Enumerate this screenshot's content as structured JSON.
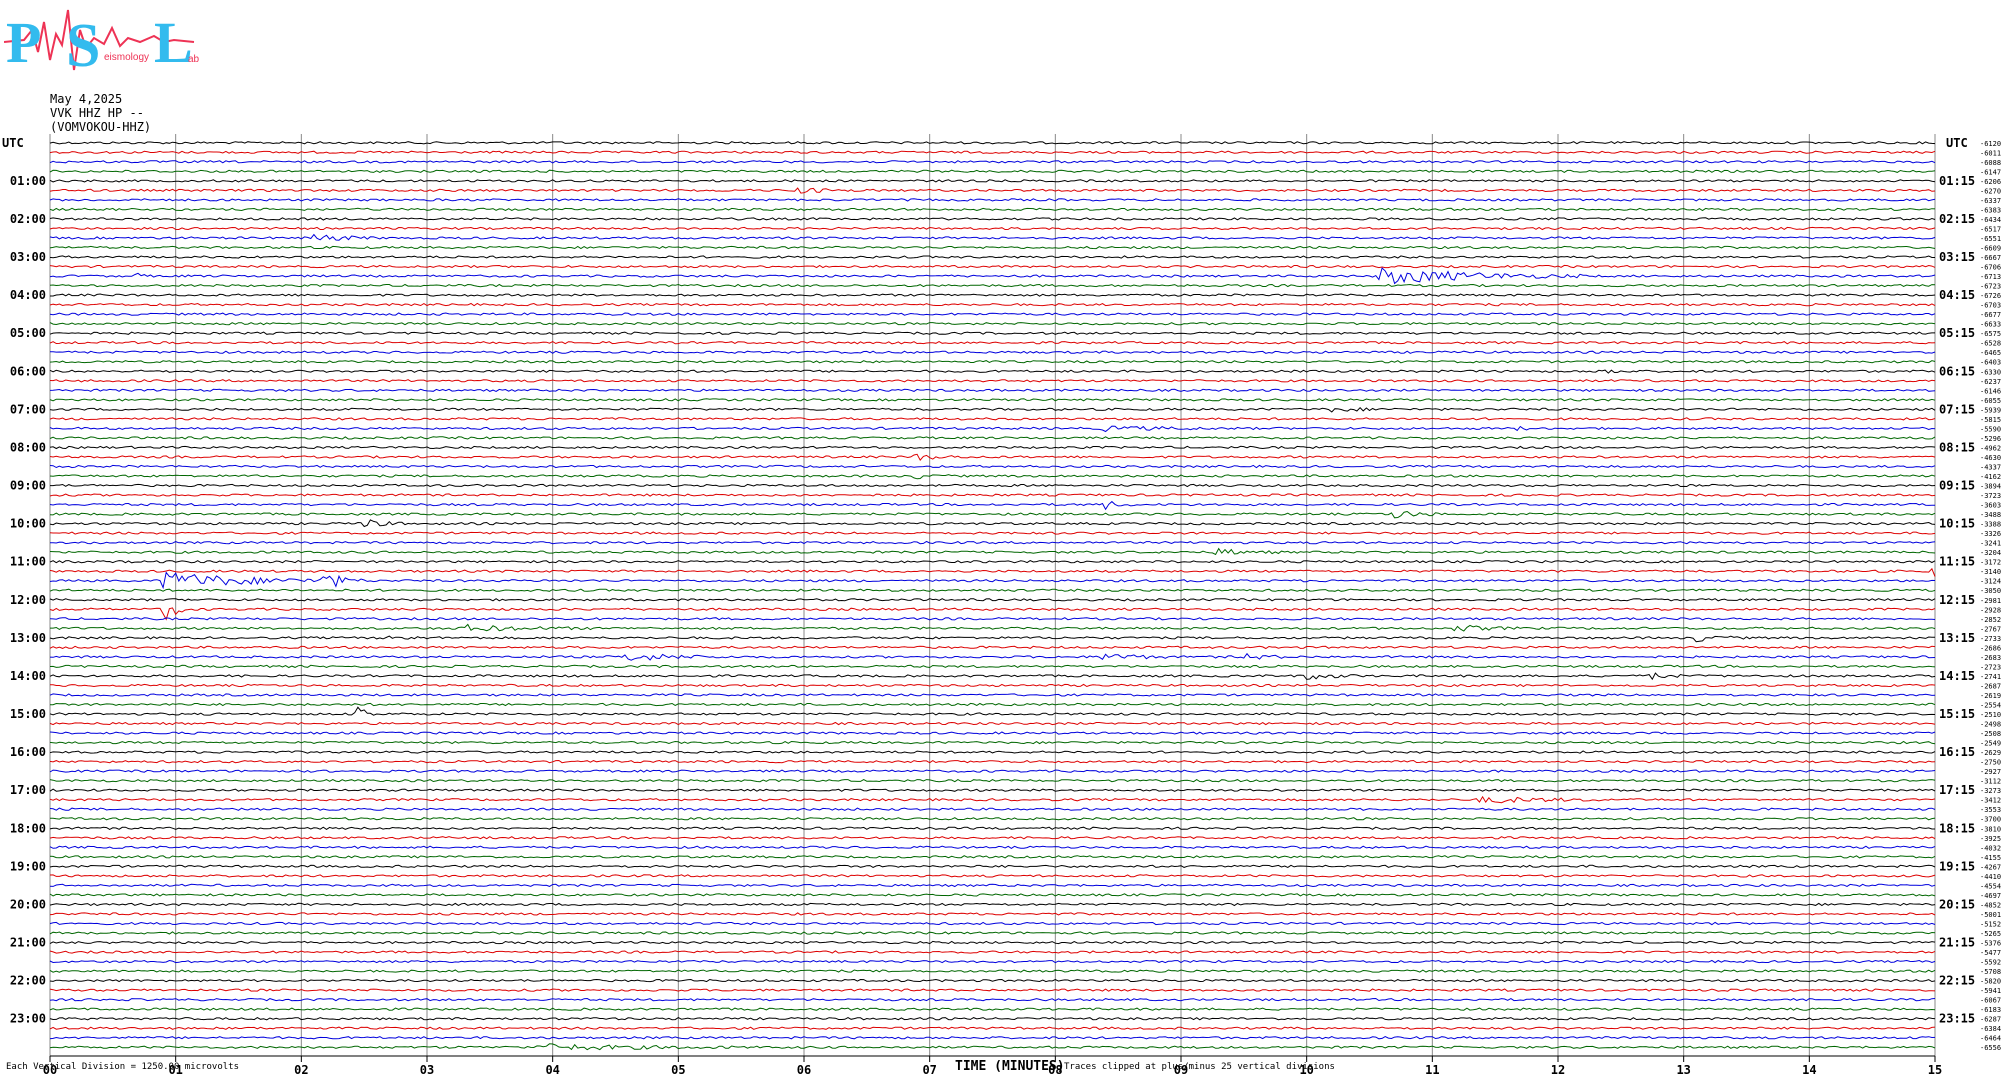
{
  "header": {
    "logo_letters": [
      "P",
      "S",
      "L"
    ],
    "logo_words": [
      "eismology",
      "ab"
    ],
    "date": "May 4,2025",
    "station": "VVK HHZ HP --",
    "station_id": "(VOMVOKOU-HHZ)"
  },
  "axes": {
    "left_title": "UTC",
    "right_title": "UTC",
    "x_title": "TIME (MINUTES)",
    "left_hour_labels": [
      "01:00",
      "02:00",
      "03:00",
      "04:00",
      "05:00",
      "06:00",
      "07:00",
      "08:00",
      "09:00",
      "10:00",
      "11:00",
      "12:00",
      "13:00",
      "14:00",
      "15:00",
      "16:00",
      "17:00",
      "18:00",
      "19:00",
      "20:00",
      "21:00",
      "22:00",
      "23:00"
    ],
    "right_hour_labels": [
      "01:15",
      "02:15",
      "03:15",
      "04:15",
      "05:15",
      "06:15",
      "07:15",
      "08:15",
      "09:15",
      "10:15",
      "11:15",
      "12:15",
      "13:15",
      "14:15",
      "15:15",
      "16:15",
      "17:15",
      "18:15",
      "19:15",
      "20:15",
      "21:15",
      "22:15",
      "23:15"
    ],
    "x_tick_labels": [
      "00",
      "01",
      "02",
      "03",
      "04",
      "05",
      "06",
      "07",
      "08",
      "09",
      "10",
      "11",
      "12",
      "13",
      "14",
      "15"
    ]
  },
  "footer": {
    "scale_note": "Each Vertical Division = 1250.00 microvolts",
    "clip_note": "Traces clipped at plus/minus 25 vertical divisions"
  },
  "colors": {
    "trace_cycle": [
      "#000000",
      "#dd0000",
      "#0000dd",
      "#006600"
    ],
    "grid": "#888888",
    "logo_blue": "#33bbee",
    "logo_red": "#ee3355"
  },
  "chart_data": {
    "type": "line",
    "x_unit": "minutes",
    "xlim": [
      0,
      15
    ],
    "traces_per_hour": 4,
    "trace_count": 96,
    "row_offsets": [
      "-6120",
      "-6011",
      "-6088",
      "-6147",
      "-6206",
      "-6270",
      "-6337",
      "-6383",
      "-6434",
      "-6517",
      "-6551",
      "-6609",
      "-6667",
      "-6706",
      "-6713",
      "-6723",
      "-6726",
      "-6703",
      "-6677",
      "-6633",
      "-6575",
      "-6528",
      "-6465",
      "-6403",
      "-6330",
      "-6237",
      "-6146",
      "-6055",
      "-5939",
      "-5815",
      "-5590",
      "-5296",
      "-4962",
      "-4630",
      "-4337",
      "-4162",
      "-3894",
      "-3723",
      "-3603",
      "-3488",
      "-3388",
      "-3326",
      "-3241",
      "-3204",
      "-3172",
      "-3140",
      "-3124",
      "-3050",
      "-2981",
      "-2928",
      "-2852",
      "-2767",
      "-2733",
      "-2686",
      "-2683",
      "-2723",
      "-2741",
      "-2687",
      "-2619",
      "-2554",
      "-2510",
      "-2498",
      "-2508",
      "-2549",
      "-2629",
      "-2750",
      "-2927",
      "-3112",
      "-3273",
      "-3412",
      "-3553",
      "-3700",
      "-3810",
      "-3925",
      "-4032",
      "-4155",
      "-4267",
      "-4410",
      "-4554",
      "-4697",
      "-4852",
      "-5001",
      "-5152",
      "-5265",
      "-5376",
      "-5477",
      "-5592",
      "-5708",
      "-5820",
      "-5941",
      "-6067",
      "-6183",
      "-6287",
      "-6384",
      "-6464",
      "-6556"
    ],
    "events": [
      {
        "row": 5,
        "minute": 5.9,
        "amp": 3,
        "dur": 0.5
      },
      {
        "row": 10,
        "minute": 2.1,
        "amp": 4,
        "dur": 0.5
      },
      {
        "row": 14,
        "minute": 10.6,
        "amp": 8,
        "dur": 1.6
      },
      {
        "row": 14,
        "minute": 0.7,
        "amp": 2,
        "dur": 0.1
      },
      {
        "row": 24,
        "minute": 12.4,
        "amp": 5,
        "dur": 0.15
      },
      {
        "row": 28,
        "minute": 10.2,
        "amp": 2,
        "dur": 0.5
      },
      {
        "row": 30,
        "minute": 8.4,
        "amp": 2,
        "dur": 1.0
      },
      {
        "row": 30,
        "minute": 11.7,
        "amp": 2,
        "dur": 0.1
      },
      {
        "row": 33,
        "minute": 6.9,
        "amp": 3,
        "dur": 0.4
      },
      {
        "row": 35,
        "minute": 6.9,
        "amp": 2,
        "dur": 0.3
      },
      {
        "row": 38,
        "minute": 8.4,
        "amp": 4,
        "dur": 0.2
      },
      {
        "row": 39,
        "minute": 10.7,
        "amp": 4,
        "dur": 0.4
      },
      {
        "row": 40,
        "minute": 2.5,
        "amp": 5,
        "dur": 0.3
      },
      {
        "row": 43,
        "minute": 9.3,
        "amp": 3,
        "dur": 0.5
      },
      {
        "row": 45,
        "minute": 15.0,
        "amp": 5,
        "dur": 0.3
      },
      {
        "row": 46,
        "minute": 0.9,
        "amp": 9,
        "dur": 1.4
      },
      {
        "row": 46,
        "minute": 2.2,
        "amp": 9,
        "dur": 0.3
      },
      {
        "row": 49,
        "minute": 0.9,
        "amp": 14,
        "dur": 0.2
      },
      {
        "row": 51,
        "minute": 3.3,
        "amp": 3,
        "dur": 1.0
      },
      {
        "row": 51,
        "minute": 11.2,
        "amp": 3,
        "dur": 0.5
      },
      {
        "row": 52,
        "minute": 2.7,
        "amp": 3,
        "dur": 0.3
      },
      {
        "row": 52,
        "minute": 13.1,
        "amp": 3,
        "dur": 0.4
      },
      {
        "row": 54,
        "minute": 4.6,
        "amp": 4,
        "dur": 0.8
      },
      {
        "row": 54,
        "minute": 8.4,
        "amp": 4,
        "dur": 0.5
      },
      {
        "row": 54,
        "minute": 9.5,
        "amp": 3,
        "dur": 0.4
      },
      {
        "row": 56,
        "minute": 10.0,
        "amp": 3,
        "dur": 0.5
      },
      {
        "row": 56,
        "minute": 12.7,
        "amp": 4,
        "dur": 0.3
      },
      {
        "row": 60,
        "minute": 2.45,
        "amp": 6,
        "dur": 0.2
      },
      {
        "row": 69,
        "minute": 11.4,
        "amp": 3,
        "dur": 1.0
      },
      {
        "row": 95,
        "minute": 3.9,
        "amp": 3,
        "dur": 1.6
      }
    ]
  }
}
